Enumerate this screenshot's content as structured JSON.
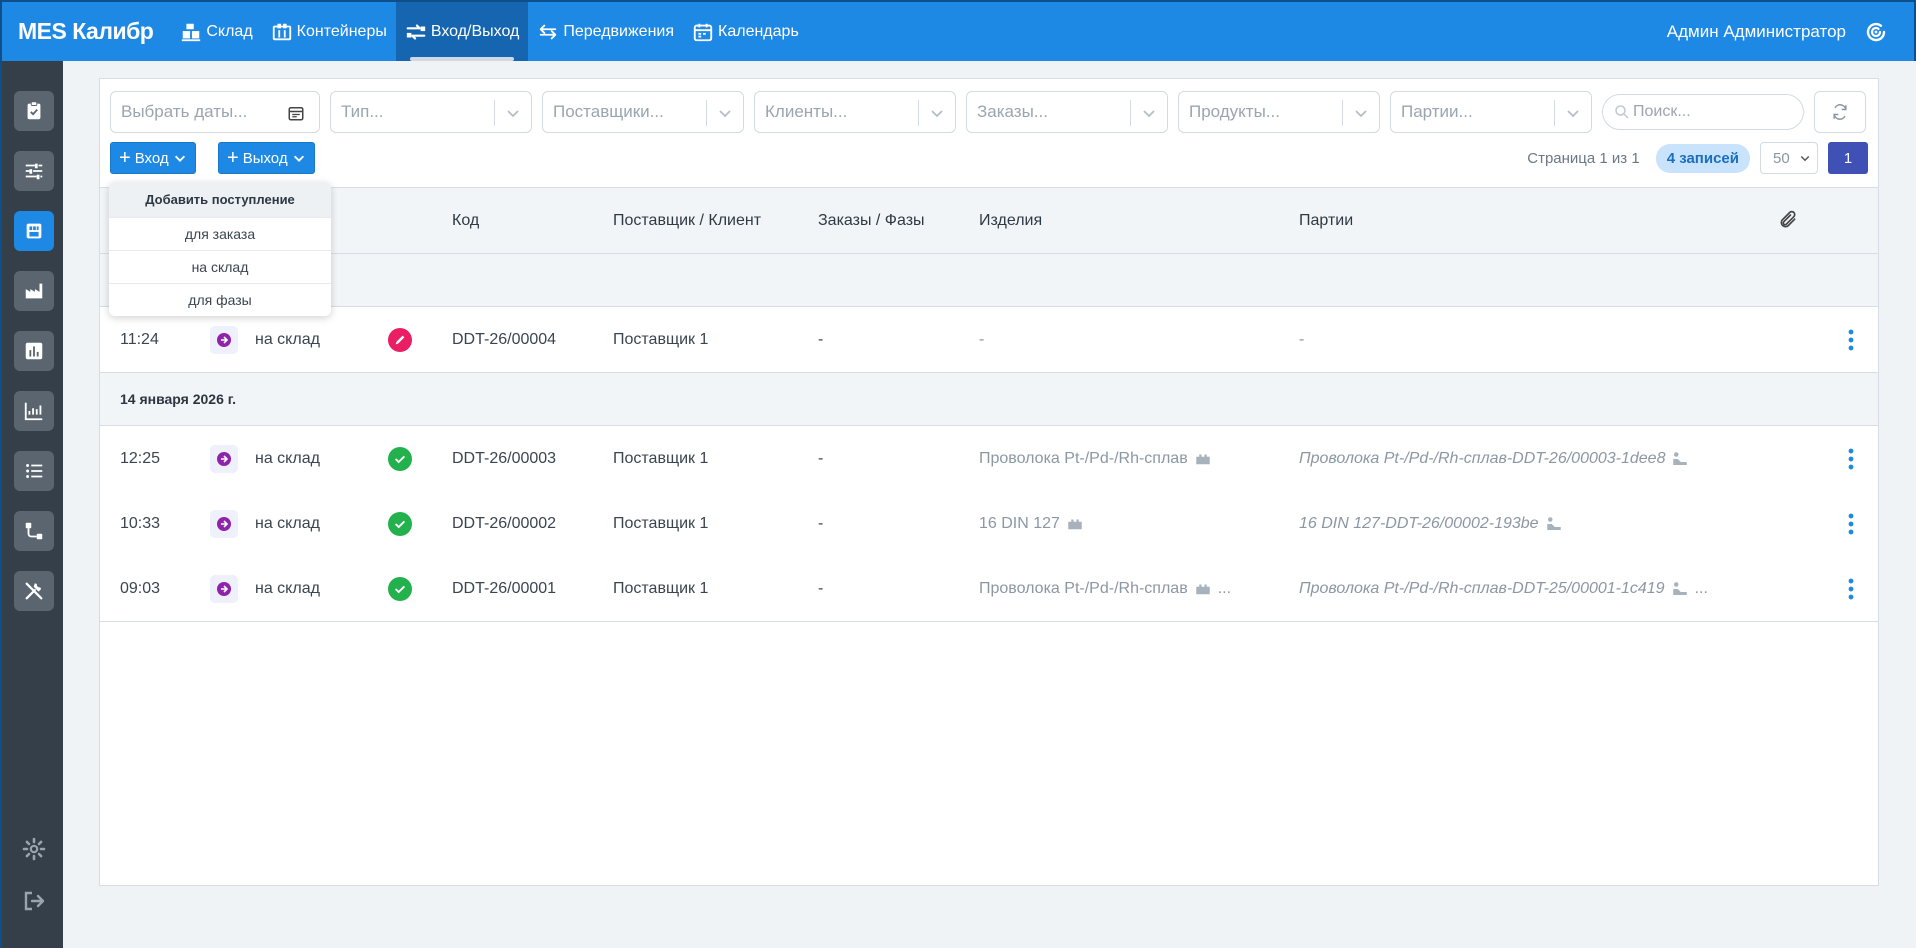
{
  "app": {
    "brand": "MES Калибр"
  },
  "nav": [
    {
      "label": "Склад",
      "icon": "warehouse-icon"
    },
    {
      "label": "Контейнеры",
      "icon": "containers-icon"
    },
    {
      "label": "Вход/Выход",
      "icon": "swap-icon",
      "active": true
    },
    {
      "label": "Передвижения",
      "icon": "arrows-icon"
    },
    {
      "label": "Календарь",
      "icon": "calendar-icon"
    }
  ],
  "user": {
    "name": "Админ Администратор"
  },
  "filters": {
    "date_placeholder": "Выбрать даты...",
    "type_placeholder": "Тип...",
    "suppliers_placeholder": "Поставщики...",
    "clients_placeholder": "Клиенты...",
    "orders_placeholder": "Заказы...",
    "products_placeholder": "Продукты...",
    "batches_placeholder": "Партии...",
    "search_placeholder": "Поиск..."
  },
  "actions": {
    "in_label": "Вход",
    "out_label": "Выход"
  },
  "pager": {
    "page_text": "Страница 1 из 1",
    "records_badge": "4 записей",
    "per_page": "50",
    "current_page": "1"
  },
  "dropdown": {
    "header": "Добавить поступление",
    "items": [
      "для заказа",
      "на склад",
      "для фазы"
    ]
  },
  "table": {
    "columns": {
      "code": "Код",
      "partner": "Поставщик / Клиент",
      "orders": "Заказы / Фазы",
      "products": "Изделия",
      "batches": "Партии"
    },
    "groups": [
      {
        "date": "",
        "rows": [
          {
            "time": "11:24",
            "type": "на склад",
            "status": "draft",
            "code": "DDT-26/00004",
            "partner": "Поставщик 1",
            "orders": "-",
            "products": "-",
            "batches": "-"
          }
        ]
      },
      {
        "date": "14 января 2026 г.",
        "rows": [
          {
            "time": "12:25",
            "type": "на склад",
            "status": "done",
            "code": "DDT-26/00003",
            "partner": "Поставщик 1",
            "orders": "-",
            "products": "Проволока Pt-/Pd-/Rh-сплав",
            "batches": "Проволока Pt-/Pd-/Rh-сплав-DDT-26/00003-1dee8"
          },
          {
            "time": "10:33",
            "type": "на склад",
            "status": "done",
            "code": "DDT-26/00002",
            "partner": "Поставщик 1",
            "orders": "-",
            "products": "16 DIN 127",
            "batches": "16 DIN 127-DDT-26/00002-193be"
          },
          {
            "time": "09:03",
            "type": "на склад",
            "status": "done",
            "code": "DDT-26/00001",
            "partner": "Поставщик 1",
            "orders": "-",
            "products": "Проволока Pt-/Pd-/Rh-сплав",
            "products_more": "...",
            "batches": "Проволока Pt-/Pd-/Rh-сплав-DDT-25/00001-1c419",
            "batches_more": "..."
          }
        ]
      }
    ]
  },
  "colors": {
    "primary": "#1e88e5",
    "sidebar": "#343f4a",
    "draft": "#e91e63",
    "done": "#22b14c",
    "direction": "#8e24aa",
    "page_active": "#3f51b5"
  }
}
